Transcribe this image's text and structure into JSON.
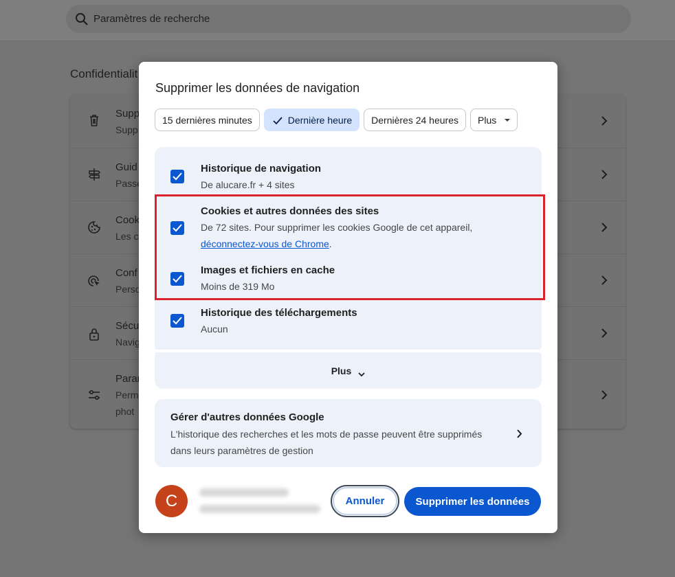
{
  "search": {
    "placeholder": "Paramètres de recherche",
    "icon": "search-icon"
  },
  "background": {
    "section_title": "Confidentialit",
    "rows": [
      {
        "icon": "trash-icon",
        "title": "Supp",
        "subtitle": "Supp"
      },
      {
        "icon": "signpost-icon",
        "title": "Guid",
        "subtitle": "Passe"
      },
      {
        "icon": "cookie-icon",
        "title": "Cook",
        "subtitle": "Les c"
      },
      {
        "icon": "cursor-target-icon",
        "title": "Conf",
        "subtitle": "Perso"
      },
      {
        "icon": "lock-icon",
        "title": "Sécu",
        "subtitle": "Navig"
      },
      {
        "icon": "tune-icon",
        "title": "Param",
        "subtitle": "Perm",
        "subtitle2": "phot"
      }
    ]
  },
  "dialog": {
    "title": "Supprimer les données de navigation",
    "time_ranges": [
      {
        "label": "15 dernières minutes",
        "selected": false
      },
      {
        "label": "Dernière heure",
        "selected": true
      },
      {
        "label": "Dernières 24 heures",
        "selected": false
      }
    ],
    "time_more": "Plus",
    "options": [
      {
        "label": "Historique de navigation",
        "detail": "De alucare.fr + 4 sites",
        "checked": true
      },
      {
        "label": "Cookies et autres données des sites",
        "detail": "De 72 sites. Pour supprimer les cookies Google de cet appareil,",
        "link": "déconnectez-vous de Chrome",
        "link_suffix": ".",
        "checked": true
      },
      {
        "label": "Images et fichiers en cache",
        "detail": "Moins de 319 Mo",
        "checked": true
      },
      {
        "label": "Historique des téléchargements",
        "detail": "Aucun",
        "checked": true
      }
    ],
    "more_label": "Plus",
    "google": {
      "title": "Gérer d'autres données Google",
      "description": "L'historique des recherches et les mots de passe peuvent être supprimés dans leurs paramètres de gestion"
    },
    "avatar_letter": "C",
    "cancel_label": "Annuler",
    "delete_label": "Supprimer les données"
  },
  "colors": {
    "accent": "#0b57d0",
    "highlight_box": "#d9222a",
    "avatar": "#c5421a"
  }
}
